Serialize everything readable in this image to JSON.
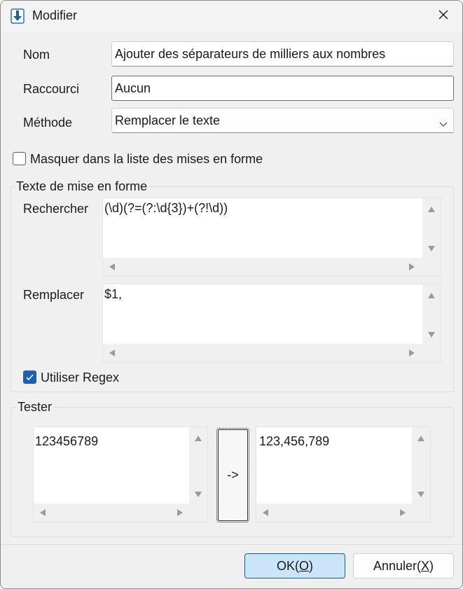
{
  "window": {
    "title": "Modifier",
    "icon": "download-arrow-icon",
    "close_icon": "close-icon"
  },
  "form": {
    "name_label": "Nom",
    "name_value": "Ajouter des séparateurs de milliers aux nombres",
    "shortcut_label": "Raccourci",
    "shortcut_value": "Aucun",
    "method_label": "Méthode",
    "method_value": "Remplacer le texte",
    "hide_checkbox_label": "Masquer dans la liste des mises en forme",
    "hide_checked": false
  },
  "format_group": {
    "title": "Texte de mise en forme",
    "search_label": "Rechercher",
    "search_value": "(\\d)(?=(?:\\d{3})+(?!\\d))",
    "replace_label": "Remplacer",
    "replace_value": "$1,",
    "regex_label": "Utiliser Regex",
    "regex_checked": true
  },
  "test_group": {
    "title": "Tester",
    "input_value": "123456789",
    "run_label": "->",
    "output_value": "123,456,789"
  },
  "footer": {
    "ok_prefix": "OK(",
    "ok_mnemonic": "O",
    "ok_suffix": ")",
    "cancel_prefix": "Annuler(",
    "cancel_mnemonic": "X",
    "cancel_suffix": ")"
  },
  "colors": {
    "accent": "#1e5fb4",
    "primary_button_bg": "#cce4f7",
    "primary_button_border": "#0067c0"
  }
}
